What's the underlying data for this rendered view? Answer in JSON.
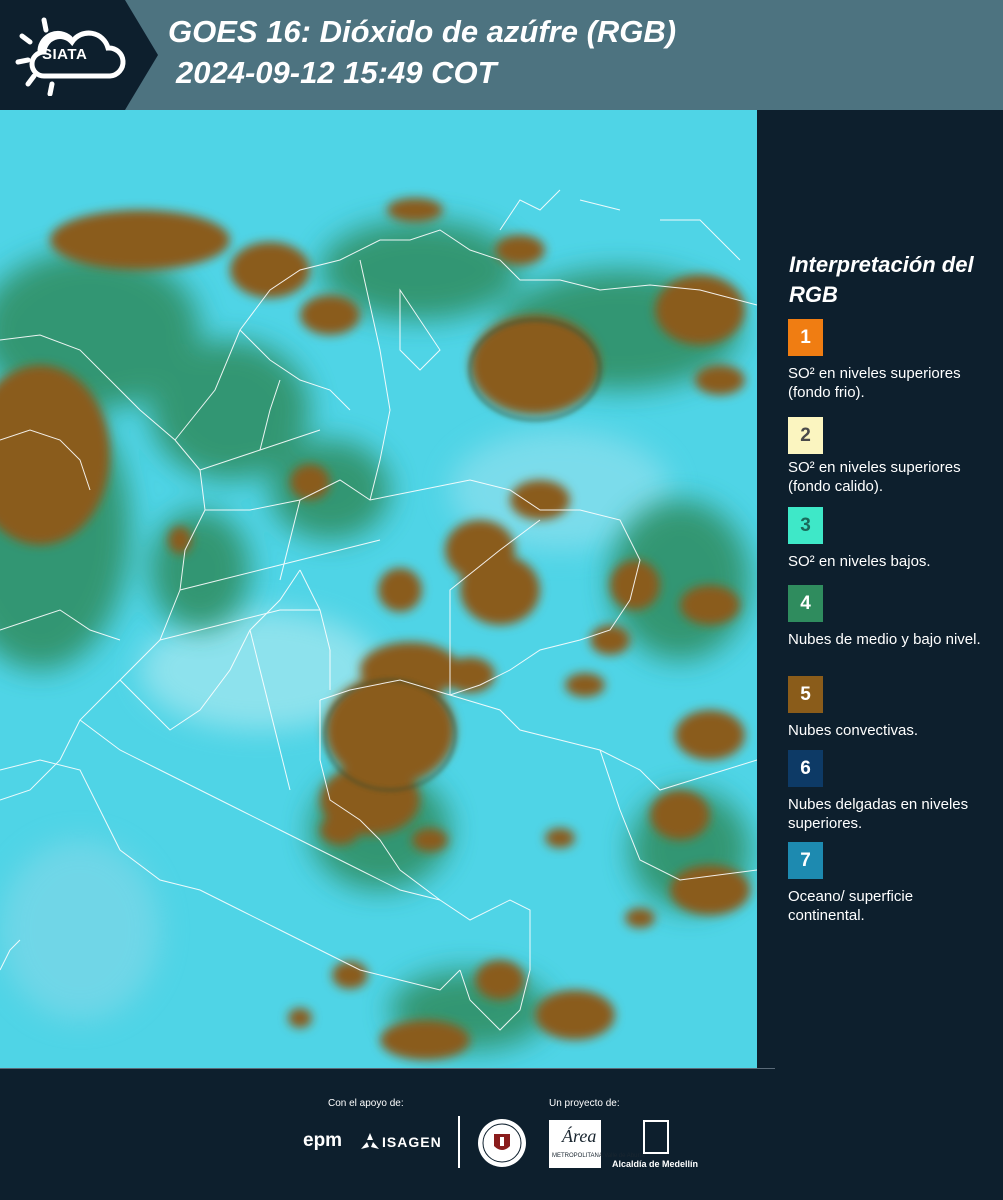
{
  "header": {
    "logo_text": "SIATA",
    "title_line1": "GOES 16: Dióxido de azúfre (RGB)",
    "title_line2": "2024-09-12 15:49 COT"
  },
  "legend": {
    "title": "Interpretación del RGB",
    "items": [
      {
        "number": "1",
        "color": "#f07d12",
        "text": "SO² en niveles superiores (fondo frio)."
      },
      {
        "number": "2",
        "color": "#fbf5c0",
        "text": "SO² en niveles superiores (fondo calido)."
      },
      {
        "number": "3",
        "color": "#3ee8c8",
        "text": "SO² en niveles bajos."
      },
      {
        "number": "4",
        "color": "#2f8c5e",
        "text": "Nubes de medio y bajo nivel."
      },
      {
        "number": "5",
        "color": "#8a5c1a",
        "text": "Nubes convectivas."
      },
      {
        "number": "6",
        "color": "#0d3a66",
        "text": "Nubes delgadas en niveles superiores."
      },
      {
        "number": "7",
        "color": "#1d8ab0",
        "text": "Oceano/ superficie continental."
      }
    ]
  },
  "footer": {
    "support_label": "Con el apoyo de:",
    "project_label": "Un proyecto de:",
    "epm": "epm",
    "isagen": "ISAGEN",
    "area_logo": "Área",
    "area_sub": "METROPOLITANA Valle de Aburrá",
    "alcaldia": "Alcaldía de Medellín"
  },
  "colors": {
    "background": "#0d1f2d",
    "header_band": "#4d7380",
    "map_base": "#4fd4e6",
    "convective_cloud": "#8a5c1a",
    "mid_low_cloud": "#2f8c5e"
  }
}
